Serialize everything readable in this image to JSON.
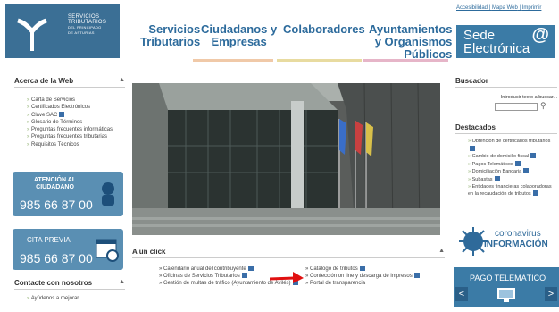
{
  "header": {
    "logo_lines": [
      "SERVICIOS",
      "TRIBUTARIOS",
      "DEL PRINCIPADO",
      "DE ASTURIAS"
    ],
    "nav": [
      {
        "label": "Servicios\nTributarios"
      },
      {
        "label": "Ciudadanos y\nEmpresas"
      },
      {
        "label": "Colaboradores"
      },
      {
        "label": "Ayuntamientos\ny Organismos\nPúblicos"
      }
    ],
    "top_links": [
      "Accesibilidad",
      "Mapa Web",
      "Imprimir"
    ],
    "sede_label": "Sede\nElectrónica",
    "sede_symbol": "@"
  },
  "left": {
    "acerca_title": "Acerca de la Web",
    "acerca_items": [
      "Carta de Servicios",
      "Certificados Electrónicos",
      "Clave SAC",
      "Glosario de Términos",
      "Preguntas frecuentes informáticas",
      "Preguntas frecuentes tributarias",
      "Requisitos Técnicos"
    ],
    "atencion_label": "ATENCIÓN AL\nCIUDADANO",
    "atencion_phone": "985 66 87 00",
    "cita_label": "CITA PREVIA",
    "cita_phone": "985 66 87 00",
    "contacte_title": "Contacte con nosotros",
    "contacte_items": [
      "Ayúdenos a mejorar"
    ]
  },
  "center": {
    "section_title": "A un click",
    "links_left": [
      "Calendario anual del contribuyente",
      "Oficinas de Servicios Tributarios",
      "Gestión de multas de tráfico (Ayuntamiento de Avilés)"
    ],
    "links_right": [
      "Catálogo de tributos",
      "Confección on line y descarga de impresos",
      "Portal de transparencia"
    ]
  },
  "right": {
    "buscador_title": "Buscador",
    "search_placeholder": "Introducir texto a buscar...",
    "destacados_title": "Destacados",
    "destacados_items": [
      "Obtención de certificados tributarios",
      "Cambio de domicilio fiscal",
      "Pagos Telemáticos",
      "Domiciliación Bancaria",
      "Subastas",
      "Entidades financieras colaboradoras en la recaudación de tributos"
    ],
    "corona_line1": "coronavirus",
    "corona_line2": "INFORMACIÓN",
    "pago_label": "PAGO TELEMÁTICO",
    "prev_symbol": "<",
    "next_symbol": ">"
  }
}
